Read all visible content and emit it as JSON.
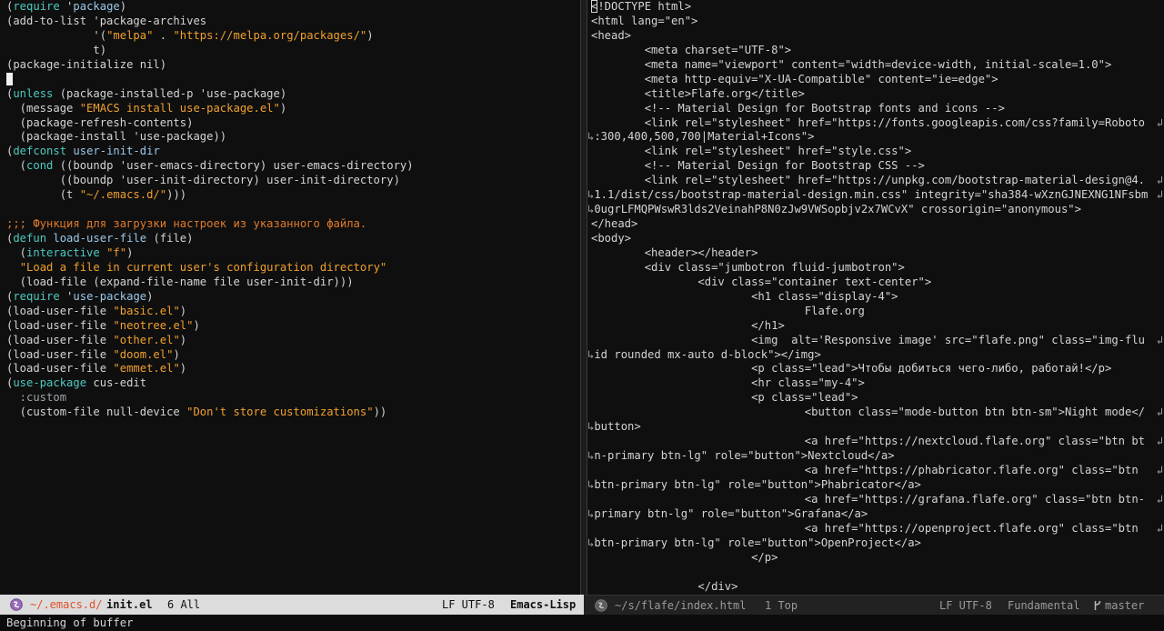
{
  "left_buffer": {
    "lines": [
      [
        [
          "(",
          ""
        ],
        [
          "require",
          "kw"
        ],
        [
          " '",
          ""
        ],
        [
          "package",
          "fn"
        ],
        [
          ")",
          ""
        ]
      ],
      [
        [
          "(add-to-list 'package-archives",
          ""
        ]
      ],
      [
        [
          "             '(",
          ""
        ],
        [
          "\"melpa\"",
          "str"
        ],
        [
          " . ",
          ""
        ],
        [
          "\"https://melpa.org/packages/\"",
          "str"
        ],
        [
          ")",
          ""
        ]
      ],
      [
        [
          "             t)",
          ""
        ]
      ],
      [
        [
          "(package-initialize nil)",
          ""
        ]
      ],
      [
        [
          "__CURSOR__",
          "cursor"
        ]
      ],
      [
        [
          "(",
          ""
        ],
        [
          "unless",
          "kw"
        ],
        [
          " (package-installed-p 'use-package)",
          ""
        ]
      ],
      [
        [
          "  (message ",
          ""
        ],
        [
          "\"EMACS install use-package.el\"",
          "str"
        ],
        [
          ")",
          ""
        ]
      ],
      [
        [
          "  (package-refresh-contents)",
          ""
        ]
      ],
      [
        [
          "  (package-install 'use-package))",
          ""
        ]
      ],
      [
        [
          "(",
          ""
        ],
        [
          "defconst",
          "kw"
        ],
        [
          " ",
          ""
        ],
        [
          "user-init-dir",
          "fn"
        ]
      ],
      [
        [
          "  (",
          ""
        ],
        [
          "cond",
          "kw"
        ],
        [
          " ((boundp 'user-emacs-directory) user-emacs-directory)",
          ""
        ]
      ],
      [
        [
          "        ((boundp 'user-init-directory) user-init-directory)",
          ""
        ]
      ],
      [
        [
          "        (t ",
          ""
        ],
        [
          "\"~/.emacs.d/\"",
          "str"
        ],
        [
          ")))",
          ""
        ]
      ],
      [
        [
          "",
          ""
        ]
      ],
      [
        [
          ";;; Функция для загрузки настроек из указанного файла.",
          "cm"
        ]
      ],
      [
        [
          "(",
          ""
        ],
        [
          "defun",
          "kw"
        ],
        [
          " ",
          ""
        ],
        [
          "load-user-file",
          "fn"
        ],
        [
          " (file)",
          ""
        ]
      ],
      [
        [
          "  (",
          ""
        ],
        [
          "interactive",
          "kw"
        ],
        [
          " ",
          ""
        ],
        [
          "\"f\"",
          "str"
        ],
        [
          ")",
          ""
        ]
      ],
      [
        [
          "  ",
          ""
        ],
        [
          "\"Load a file in current user's configuration directory\"",
          "str"
        ]
      ],
      [
        [
          "  (load-file (expand-file-name file user-init-dir)))",
          ""
        ]
      ],
      [
        [
          "(",
          ""
        ],
        [
          "require",
          "kw"
        ],
        [
          " '",
          ""
        ],
        [
          "use-package",
          "fn"
        ],
        [
          ")",
          ""
        ]
      ],
      [
        [
          "(load-user-file ",
          ""
        ],
        [
          "\"basic.el\"",
          "str"
        ],
        [
          ")",
          ""
        ]
      ],
      [
        [
          "(load-user-file ",
          ""
        ],
        [
          "\"neotree.el\"",
          "str"
        ],
        [
          ")",
          ""
        ]
      ],
      [
        [
          "(load-user-file ",
          ""
        ],
        [
          "\"other.el\"",
          "str"
        ],
        [
          ")",
          ""
        ]
      ],
      [
        [
          "(load-user-file ",
          ""
        ],
        [
          "\"doom.el\"",
          "str"
        ],
        [
          ")",
          ""
        ]
      ],
      [
        [
          "(load-user-file ",
          ""
        ],
        [
          "\"emmet.el\"",
          "str"
        ],
        [
          ")",
          ""
        ]
      ],
      [
        [
          "(",
          ""
        ],
        [
          "use-package",
          "kw"
        ],
        [
          " cus-edit",
          ""
        ]
      ],
      [
        [
          "  :custom",
          "gr"
        ]
      ],
      [
        [
          "  (custom-file null-device ",
          ""
        ],
        [
          "\"Don't store customizations\"",
          "str"
        ],
        [
          "))",
          ""
        ]
      ]
    ]
  },
  "right_buffer": {
    "lines": [
      {
        "t": "<!DOCTYPE html>",
        "cursor_first": true
      },
      {
        "t": "<html lang=\"en\">"
      },
      {
        "t": "<head>"
      },
      {
        "t": "        <meta charset=\"UTF-8\">"
      },
      {
        "t": "        <meta name=\"viewport\" content=\"width=device-width, initial-scale=1.0\">"
      },
      {
        "t": "        <meta http-equiv=\"X-UA-Compatible\" content=\"ie=edge\">"
      },
      {
        "t": "        <title>Flafe.org</title>"
      },
      {
        "t": "        <!-- Material Design for Bootstrap fonts and icons -->"
      },
      {
        "t": "        <link rel=\"stylesheet\" href=\"https://fonts.googleapis.com/css?family=Roboto",
        "wrap_end": true
      },
      {
        "t": ":300,400,500,700|Material+Icons\">",
        "wrap_start": true
      },
      {
        "t": "        <link rel=\"stylesheet\" href=\"style.css\">"
      },
      {
        "t": "        <!-- Material Design for Bootstrap CSS -->"
      },
      {
        "t": "        <link rel=\"stylesheet\" href=\"https://unpkg.com/bootstrap-material-design@4.",
        "wrap_end": true
      },
      {
        "t": "1.1/dist/css/bootstrap-material-design.min.css\" integrity=\"sha384-wXznGJNEXNG1NFsbm",
        "wrap_start": true,
        "wrap_end": true
      },
      {
        "t": "0ugrLFMQPWswR3lds2VeinahP8N0zJw9VWSopbjv2x7WCvX\" crossorigin=\"anonymous\">",
        "wrap_start": true
      },
      {
        "t": "</head>"
      },
      {
        "t": "<body>"
      },
      {
        "t": "        <header></header>"
      },
      {
        "t": "        <div class=\"jumbotron fluid-jumbotron\">"
      },
      {
        "t": "                <div class=\"container text-center\">"
      },
      {
        "t": "                        <h1 class=\"display-4\">"
      },
      {
        "t": "                                Flafe.org"
      },
      {
        "t": "                        </h1>"
      },
      {
        "t": "                        <img  alt='Responsive image' src=\"flafe.png\" class=\"img-flu",
        "wrap_end": true
      },
      {
        "t": "id rounded mx-auto d-block\"></img>",
        "wrap_start": true
      },
      {
        "t": "                        <p class=\"lead\">Чтобы добиться чего-либо, работай!</p>"
      },
      {
        "t": "                        <hr class=\"my-4\">"
      },
      {
        "t": "                        <p class=\"lead\">"
      },
      {
        "t": "                                <button class=\"mode-button btn btn-sm\">Night mode</",
        "wrap_end": true
      },
      {
        "t": "button>",
        "wrap_start": true
      },
      {
        "t": "                                <a href=\"https://nextcloud.flafe.org\" class=\"btn bt",
        "wrap_end": true
      },
      {
        "t": "n-primary btn-lg\" role=\"button\">Nextcloud</a>",
        "wrap_start": true
      },
      {
        "t": "                                <a href=\"https://phabricator.flafe.org\" class=\"btn ",
        "wrap_end": true
      },
      {
        "t": "btn-primary btn-lg\" role=\"button\">Phabricator</a>",
        "wrap_start": true
      },
      {
        "t": "                                <a href=\"https://grafana.flafe.org\" class=\"btn btn-",
        "wrap_end": true
      },
      {
        "t": "primary btn-lg\" role=\"button\">Grafana</a>",
        "wrap_start": true
      },
      {
        "t": "                                <a href=\"https://openproject.flafe.org\" class=\"btn ",
        "wrap_end": true
      },
      {
        "t": "btn-primary btn-lg\" role=\"button\">OpenProject</a>",
        "wrap_start": true
      },
      {
        "t": "                        </p>"
      },
      {
        "t": ""
      },
      {
        "t": "                </div>"
      }
    ]
  },
  "modeline_left": {
    "path": "~/.emacs.d/",
    "file": "init.el",
    "position": "6 All",
    "encoding": "LF UTF-8",
    "mode": "Emacs-Lisp"
  },
  "modeline_right": {
    "path": "~/s/flafe/index.html",
    "position": "1 Top",
    "encoding": "LF UTF-8",
    "mode": "Fundamental",
    "branch": "master"
  },
  "echo_area": {
    "message": "Beginning of buffer"
  },
  "colors": {
    "keyword": "#4ec9c0",
    "string": "#f0a030",
    "comment": "#e07a2a",
    "path_highlight": "#e0502a"
  }
}
